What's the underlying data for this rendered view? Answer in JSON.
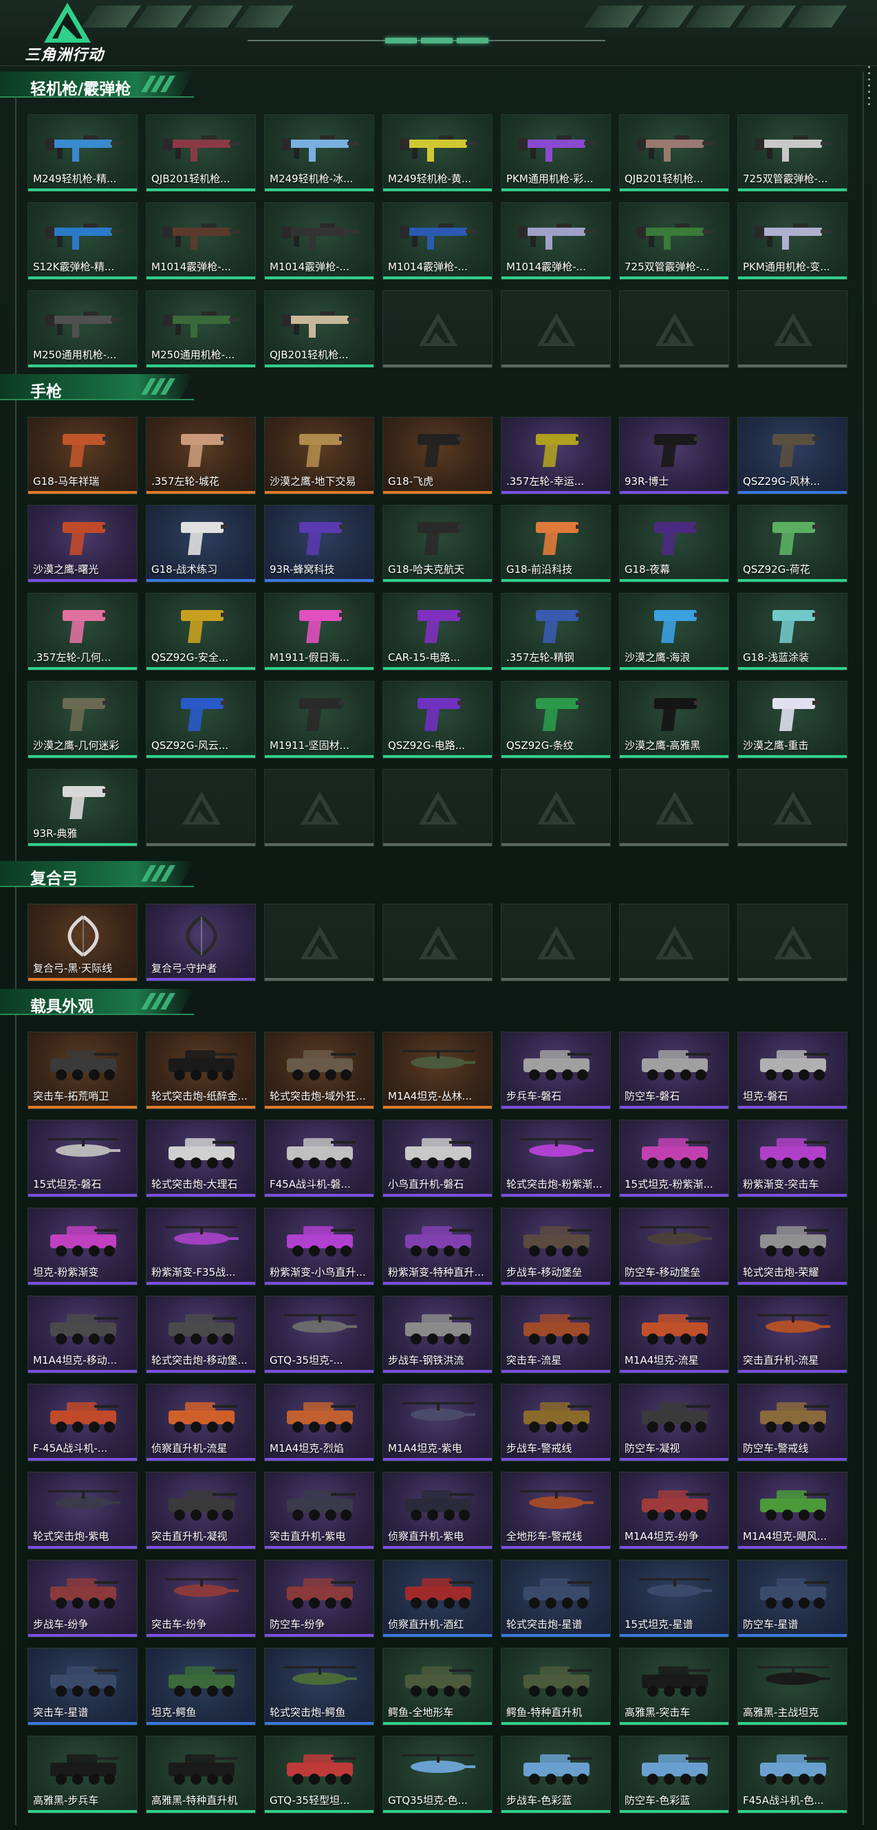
{
  "header": {
    "logo_text": "三角洲行动"
  },
  "colors": {
    "gold": "#e07a2a",
    "purple": "#7a4fe0",
    "green": "#2fd08a",
    "blue": "#3a78e0",
    "accent": "#1c7a4a"
  },
  "sections": [
    {
      "title": "轻机枪/霰弹枪",
      "kind": "gun",
      "items": [
        {
          "label": "M249轻机枪-精...",
          "rarity": "green",
          "color": "#3a8ad0"
        },
        {
          "label": "QJB201轻机枪...",
          "rarity": "green",
          "color": "#8a3a46"
        },
        {
          "label": "M249轻机枪-冰...",
          "rarity": "green",
          "color": "#7ab0e0"
        },
        {
          "label": "M249轻机枪-黄...",
          "rarity": "green",
          "color": "#d0c830"
        },
        {
          "label": "PKM通用机枪-彩...",
          "rarity": "green",
          "color": "#8a4ad0"
        },
        {
          "label": "QJB201轻机枪...",
          "rarity": "green",
          "color": "#9a7a70"
        },
        {
          "label": "725双管霰弹枪-...",
          "rarity": "green",
          "color": "#c8c8c8"
        },
        {
          "label": "S12K霰弹枪-精...",
          "rarity": "green",
          "color": "#2a7ac8"
        },
        {
          "label": "M1014霰弹枪-...",
          "rarity": "green",
          "color": "#5a3a2a"
        },
        {
          "label": "M1014霰弹枪-...",
          "rarity": "green",
          "color": "#333333"
        },
        {
          "label": "M1014霰弹枪-...",
          "rarity": "green",
          "color": "#2a5ab0"
        },
        {
          "label": "M1014霰弹枪-...",
          "rarity": "green",
          "color": "#a0a0c8"
        },
        {
          "label": "725双管霰弹枪-...",
          "rarity": "green",
          "color": "#3a7a3a"
        },
        {
          "label": "PKM通用机枪-变...",
          "rarity": "green",
          "color": "#b0b0d0"
        },
        {
          "label": "M250通用机枪-...",
          "rarity": "green",
          "color": "#505050"
        },
        {
          "label": "M250通用机枪-...",
          "rarity": "green",
          "color": "#3a6a3a"
        },
        {
          "label": "QJB201轻机枪...",
          "rarity": "green",
          "color": "#c8b89a"
        },
        {
          "label": "",
          "rarity": "empty"
        },
        {
          "label": "",
          "rarity": "empty"
        },
        {
          "label": "",
          "rarity": "empty"
        },
        {
          "label": "",
          "rarity": "empty"
        }
      ]
    },
    {
      "title": "手枪",
      "kind": "pistol",
      "items": [
        {
          "label": "G18-马年祥瑞",
          "rarity": "gold",
          "color": "#c0552a"
        },
        {
          "label": ".357左轮-城花",
          "rarity": "gold",
          "color": "#c89a7a"
        },
        {
          "label": "沙漠之鹰-地下交易",
          "rarity": "gold",
          "color": "#b08a4a"
        },
        {
          "label": "G18-飞虎",
          "rarity": "gold",
          "color": "#222222"
        },
        {
          "label": ".357左轮-幸运...",
          "rarity": "purple",
          "color": "#b0a020"
        },
        {
          "label": "93R-博士",
          "rarity": "purple",
          "color": "#1a1a1a"
        },
        {
          "label": "QSZ29G-风林...",
          "rarity": "blue",
          "color": "#5a5040"
        },
        {
          "label": "沙漠之鹰-曙光",
          "rarity": "purple",
          "color": "#c04a2a"
        },
        {
          "label": "G18-战术练习",
          "rarity": "blue",
          "color": "#e0e0e0"
        },
        {
          "label": "93R-蜂窝科技",
          "rarity": "blue",
          "color": "#5a3ab0"
        },
        {
          "label": "G18-哈夫克航天",
          "rarity": "green",
          "color": "#2a2a2a"
        },
        {
          "label": "G18-前沿科技",
          "rarity": "green",
          "color": "#e07a3a"
        },
        {
          "label": "G18-夜幕",
          "rarity": "green",
          "color": "#4a2a80"
        },
        {
          "label": "QSZ92G-荷花",
          "rarity": "green",
          "color": "#5ab060"
        },
        {
          "label": ".357左轮-几何...",
          "rarity": "green",
          "color": "#e070a0"
        },
        {
          "label": "QSZ92G-安全...",
          "rarity": "green",
          "color": "#c8a020"
        },
        {
          "label": "M1911-假日海...",
          "rarity": "green",
          "color": "#e050c0"
        },
        {
          "label": "CAR-15-电路...",
          "rarity": "green",
          "color": "#8030c0"
        },
        {
          "label": ".357左轮-精钢",
          "rarity": "green",
          "color": "#3a5ab0"
        },
        {
          "label": "沙漠之鹰-海浪",
          "rarity": "green",
          "color": "#3aa0e0"
        },
        {
          "label": "G18-浅蓝涂装",
          "rarity": "green",
          "color": "#70c8c8"
        },
        {
          "label": "沙漠之鹰-几何迷彩",
          "rarity": "green",
          "color": "#6a6a50"
        },
        {
          "label": "QSZ92G-风云...",
          "rarity": "green",
          "color": "#2a5ac8"
        },
        {
          "label": "M1911-坚固材...",
          "rarity": "green",
          "color": "#2a2a2a"
        },
        {
          "label": "QSZ92G-电路...",
          "rarity": "green",
          "color": "#7030c0"
        },
        {
          "label": "QSZ92G-条纹",
          "rarity": "green",
          "color": "#2a9a4a"
        },
        {
          "label": "沙漠之鹰-高雅黑",
          "rarity": "green",
          "color": "#151515"
        },
        {
          "label": "沙漠之鹰-重击",
          "rarity": "green",
          "color": "#e0e0f0"
        },
        {
          "label": "93R-典雅",
          "rarity": "green",
          "color": "#d8d8d8"
        },
        {
          "label": "",
          "rarity": "empty"
        },
        {
          "label": "",
          "rarity": "empty"
        },
        {
          "label": "",
          "rarity": "empty"
        },
        {
          "label": "",
          "rarity": "empty"
        },
        {
          "label": "",
          "rarity": "empty"
        },
        {
          "label": "",
          "rarity": "empty"
        }
      ]
    },
    {
      "title": "复合弓",
      "kind": "bow",
      "items": [
        {
          "label": "复合弓-黑·天际线",
          "rarity": "gold",
          "color": "#d8d8d8"
        },
        {
          "label": "复合弓-守护者",
          "rarity": "purple",
          "color": "#2a2a2a"
        },
        {
          "label": "",
          "rarity": "empty"
        },
        {
          "label": "",
          "rarity": "empty"
        },
        {
          "label": "",
          "rarity": "empty"
        },
        {
          "label": "",
          "rarity": "empty"
        },
        {
          "label": "",
          "rarity": "empty"
        }
      ]
    },
    {
      "title": "载具外观",
      "kind": "vehicle",
      "items": [
        {
          "label": "突击车-拓荒哨卫",
          "rarity": "gold",
          "color": "#3a3a3a"
        },
        {
          "label": "轮式突击炮-纸醉金...",
          "rarity": "gold",
          "color": "#1a1a1a"
        },
        {
          "label": "轮式突击炮-域外狂...",
          "rarity": "gold",
          "color": "#6a5a48"
        },
        {
          "label": "M1A4坦克-丛林...",
          "rarity": "gold",
          "color": "#4a5a3a"
        },
        {
          "label": "步兵车-磐石",
          "rarity": "purple",
          "color": "#a0a0a0"
        },
        {
          "label": "防空车-磐石",
          "rarity": "purple",
          "color": "#a0a0a0"
        },
        {
          "label": "坦克-磐石",
          "rarity": "purple",
          "color": "#b0b0b0"
        },
        {
          "label": "15式坦克-磐石",
          "rarity": "purple",
          "color": "#b8b8b8"
        },
        {
          "label": "轮式突击炮-大理石",
          "rarity": "purple",
          "color": "#d0d0d0"
        },
        {
          "label": "F45A战斗机-磐...",
          "rarity": "purple",
          "color": "#c0c0c0"
        },
        {
          "label": "小鸟直升机-磐石",
          "rarity": "purple",
          "color": "#c8c8c8"
        },
        {
          "label": "轮式突击炮-粉紫渐...",
          "rarity": "purple",
          "color": "#b040d0"
        },
        {
          "label": "15式坦克-粉紫渐...",
          "rarity": "purple",
          "color": "#c040b0"
        },
        {
          "label": "粉紫渐变-突击车",
          "rarity": "purple",
          "color": "#b040c8"
        },
        {
          "label": "坦克-粉紫渐变",
          "rarity": "purple",
          "color": "#c040c0"
        },
        {
          "label": "粉紫渐变-F35战...",
          "rarity": "purple",
          "color": "#a040c0"
        },
        {
          "label": "粉紫渐变-小鸟直升...",
          "rarity": "purple",
          "color": "#b040d0"
        },
        {
          "label": "粉紫渐变-特种直升...",
          "rarity": "purple",
          "color": "#8040b0"
        },
        {
          "label": "步战车-移动堡垒",
          "rarity": "purple",
          "color": "#5a4a40"
        },
        {
          "label": "防空车-移动堡垒",
          "rarity": "purple",
          "color": "#4a4038"
        },
        {
          "label": "轮式突击炮-荣耀",
          "rarity": "purple",
          "color": "#909090"
        },
        {
          "label": "M1A4坦克-移动...",
          "rarity": "purple",
          "color": "#4a4a4a"
        },
        {
          "label": "轮式突击炮-移动堡...",
          "rarity": "purple",
          "color": "#4a4a4a"
        },
        {
          "label": "GTQ-35坦克-...",
          "rarity": "purple",
          "color": "#6a6a6a"
        },
        {
          "label": "步战车-钢铁洪流",
          "rarity": "purple",
          "color": "#8a8a8a"
        },
        {
          "label": "突击车-流星",
          "rarity": "purple",
          "color": "#a04a2a"
        },
        {
          "label": "M1A4坦克-流星",
          "rarity": "purple",
          "color": "#c0502a"
        },
        {
          "label": "突击直升机-流星",
          "rarity": "purple",
          "color": "#b0502a"
        },
        {
          "label": "F-45A战斗机-...",
          "rarity": "purple",
          "color": "#c04a2a"
        },
        {
          "label": "侦察直升机-流星",
          "rarity": "purple",
          "color": "#d0602a"
        },
        {
          "label": "M1A4坦克-烈焰",
          "rarity": "purple",
          "color": "#c06030"
        },
        {
          "label": "M1A4坦克-紫电",
          "rarity": "purple",
          "color": "#4a4a6a"
        },
        {
          "label": "步战车-警戒线",
          "rarity": "purple",
          "color": "#8a6a2a"
        },
        {
          "label": "防空车-凝视",
          "rarity": "purple",
          "color": "#3a3a3a"
        },
        {
          "label": "防空车-警戒线",
          "rarity": "purple",
          "color": "#8a6a3a"
        },
        {
          "label": "轮式突击炮-紫电",
          "rarity": "purple",
          "color": "#3a3a4a"
        },
        {
          "label": "突击直升机-凝视",
          "rarity": "purple",
          "color": "#3a3a3a"
        },
        {
          "label": "突击直升机-紫电",
          "rarity": "purple",
          "color": "#3a3a4a"
        },
        {
          "label": "侦察直升机-紫电",
          "rarity": "purple",
          "color": "#2a2a3a"
        },
        {
          "label": "全地形车-警戒线",
          "rarity": "purple",
          "color": "#a04a2a"
        },
        {
          "label": "M1A4坦克-纷争",
          "rarity": "purple",
          "color": "#a03a3a"
        },
        {
          "label": "M1A4坦克-飓风...",
          "rarity": "purple",
          "color": "#4a9a3a"
        },
        {
          "label": "步战车-纷争",
          "rarity": "purple",
          "color": "#8a3a3a"
        },
        {
          "label": "突击车-纷争",
          "rarity": "purple",
          "color": "#8a3a3a"
        },
        {
          "label": "防空车-纷争",
          "rarity": "purple",
          "color": "#8a3a3a"
        },
        {
          "label": "侦察直升机-酒红",
          "rarity": "blue",
          "color": "#a02a2a"
        },
        {
          "label": "轮式突击炮-星谱",
          "rarity": "blue",
          "color": "#3a4a6a"
        },
        {
          "label": "15式坦克-星谱",
          "rarity": "blue",
          "color": "#3a4a6a"
        },
        {
          "label": "防空车-星谱",
          "rarity": "blue",
          "color": "#3a4a6a"
        },
        {
          "label": "突击车-星谱",
          "rarity": "blue",
          "color": "#3a4a6a"
        },
        {
          "label": "坦克-鳄鱼",
          "rarity": "blue",
          "color": "#3a6a3a"
        },
        {
          "label": "轮式突击炮-鳄鱼",
          "rarity": "blue",
          "color": "#4a6a3a"
        },
        {
          "label": "鳄鱼-全地形车",
          "rarity": "green",
          "color": "#4a5a3a"
        },
        {
          "label": "鳄鱼-特种直升机",
          "rarity": "green",
          "color": "#4a5a3a"
        },
        {
          "label": "高雅黑-突击车",
          "rarity": "green",
          "color": "#1a1a1a"
        },
        {
          "label": "高雅黑-主战坦克",
          "rarity": "green",
          "color": "#1a1a1a"
        },
        {
          "label": "高雅黑-步兵车",
          "rarity": "green",
          "color": "#1a1a1a"
        },
        {
          "label": "高雅黑-特种直升机",
          "rarity": "green",
          "color": "#1a1a1a"
        },
        {
          "label": "GTQ-35轻型坦...",
          "rarity": "green",
          "color": "#c03a3a"
        },
        {
          "label": "GTQ35坦克-色...",
          "rarity": "green",
          "color": "#6aa0d0"
        },
        {
          "label": "步战车-色彩蓝",
          "rarity": "green",
          "color": "#6aa0d0"
        },
        {
          "label": "防空车-色彩蓝",
          "rarity": "green",
          "color": "#6aa0d0"
        },
        {
          "label": "F45A战斗机-色...",
          "rarity": "green",
          "color": "#6aa0d0"
        }
      ]
    }
  ]
}
